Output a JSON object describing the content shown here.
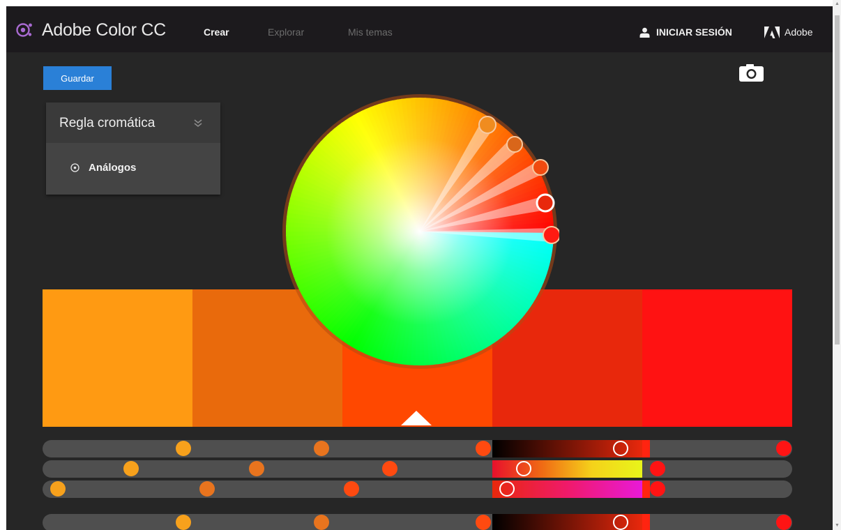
{
  "app": {
    "title": "Adobe Color CC",
    "logo_icon": "color-wheel-logo-icon"
  },
  "nav": {
    "items": [
      {
        "label": "Crear",
        "active": true
      },
      {
        "label": "Explorar",
        "active": false
      },
      {
        "label": "Mis temas",
        "active": false
      }
    ]
  },
  "account": {
    "signin_label": "INICIAR SESIÓN",
    "signin_icon": "user-icon",
    "brand_label": "Adobe",
    "brand_icon": "adobe-logo-icon"
  },
  "toolbar": {
    "save_label": "Guardar",
    "camera_icon": "camera-icon"
  },
  "color_rule": {
    "title": "Regla cromática",
    "selected_option": "Análogos",
    "chevron_icon": "double-chevron-down-icon",
    "option_icon": "radio-icon"
  },
  "palette": {
    "swatches": [
      "#ff9a12",
      "#e96a0c",
      "#ff4800",
      "#e8280c",
      "#ff1212"
    ],
    "active_index": 2
  },
  "colors": {
    "app_background": "#262626",
    "topbar": "#1c1a1d",
    "accent_button": "#2a80d7",
    "panel": "#444444",
    "slider_track": "#4f4f4f"
  }
}
